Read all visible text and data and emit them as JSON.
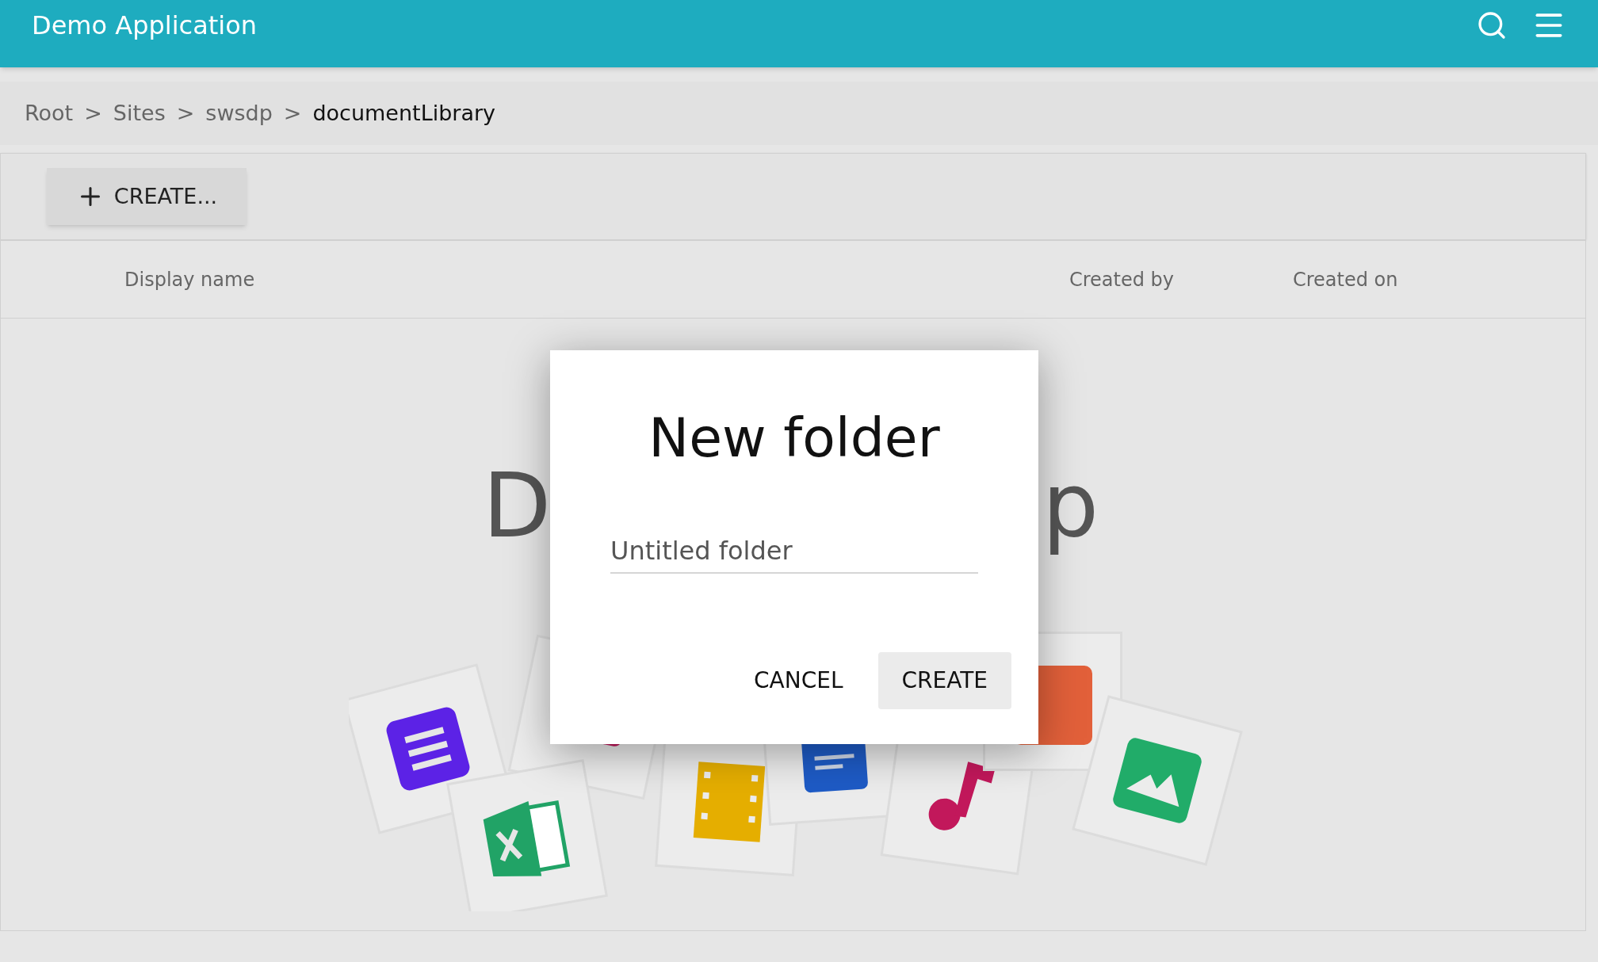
{
  "app_bar": {
    "title": "Demo Application"
  },
  "breadcrumb": [
    {
      "label": "Root",
      "current": false
    },
    {
      "label": "Sites",
      "current": false
    },
    {
      "label": "swsdp",
      "current": false
    },
    {
      "label": "documentLibrary",
      "current": true
    }
  ],
  "breadcrumb_separator": ">",
  "toolbar": {
    "create_button": "CREATE..."
  },
  "table": {
    "columns": [
      "Display name",
      "Created by",
      "Created on"
    ]
  },
  "empty_state": {
    "title_left": "D",
    "title_right": "p"
  },
  "dialog": {
    "title": "New folder",
    "name_field": {
      "value": "Untitled folder"
    },
    "buttons": [
      {
        "label": "CANCEL",
        "kind": "flat"
      },
      {
        "label": "CREATE",
        "kind": "raised"
      }
    ]
  }
}
